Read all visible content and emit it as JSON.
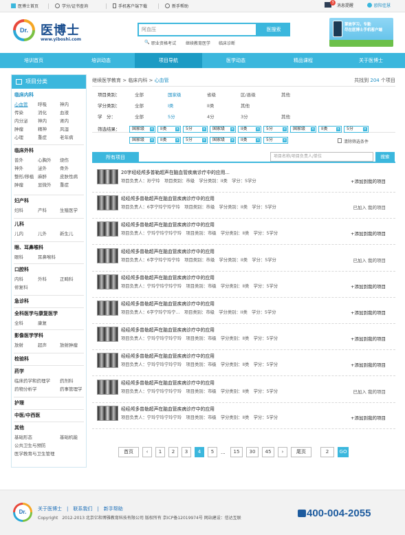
{
  "topbar": {
    "home": "医博士首页",
    "credit": "学分/证书查询",
    "mobile": "手机客户端下载",
    "help": "新手帮助",
    "messages": "消息提醒",
    "message_count": "3",
    "user": "欧阳佳慧"
  },
  "logo": {
    "badge": "Dr.",
    "name": "医博士",
    "url": "www.yiboshi.com"
  },
  "search": {
    "value": "阿血压",
    "button": "医搜索",
    "hot": [
      "职业资格考试",
      "继续教育医学",
      "临床诊断"
    ]
  },
  "banner": {
    "line1": "掌故学习，专勤",
    "line2": "尽在医博士手机客户端"
  },
  "nav": [
    "培训首页",
    "培训动态",
    "项目导航",
    "医学动态",
    "精品课程",
    "关于医博士"
  ],
  "sidebar": {
    "title": "项目分类",
    "groups": [
      {
        "name": "临床内科",
        "items": [
          "心血管",
          "呼吸",
          "神内",
          "传染",
          "消化",
          "血液",
          "内分泌",
          "神内",
          "肾内",
          "肿瘤",
          "精神",
          "风湿",
          "心理",
          "重症",
          "老年病"
        ]
      },
      {
        "name": "临床外科",
        "items": [
          "普外",
          "心胸外",
          "烧伤",
          "神外",
          "泌外",
          "骨外",
          "整形/移植",
          "麻醉",
          "皮肤性病",
          "肿瘤",
          "显微外",
          "重症"
        ]
      },
      {
        "name": "妇产科",
        "items": [
          "妇科",
          "产科",
          "生殖医学"
        ]
      },
      {
        "name": "儿科",
        "items": [
          "儿内",
          "儿外",
          "新生儿"
        ]
      },
      {
        "name": "眼、耳鼻喉科",
        "items": [
          "眼科",
          "耳鼻喉科"
        ]
      },
      {
        "name": "口腔科",
        "items": [
          "内科",
          "外科",
          "正畸科",
          "修复科"
        ]
      },
      {
        "name": "急诊科",
        "items": []
      },
      {
        "name": "全科医学与康复医学",
        "items": [
          "全科",
          "康复"
        ]
      },
      {
        "name": "影像医学学科",
        "items": [
          "放射",
          "超声",
          "放射肿瘤"
        ]
      },
      {
        "name": "检验科",
        "items": []
      },
      {
        "name": "药学",
        "items": [
          "临床药学和药理学",
          "药剂科",
          "药物分析学",
          "药事管理学"
        ]
      },
      {
        "name": "护理",
        "items": []
      },
      {
        "name": "中医/中西医",
        "items": []
      },
      {
        "name": "其他",
        "items": [
          "基础形态",
          "基础机能",
          "公共卫生与预防",
          "医学教育与卫生管理"
        ]
      }
    ]
  },
  "breadcrumb": {
    "a": "继续医学教育",
    "b": "临床内科",
    "c": "心血管"
  },
  "found": {
    "prefix": "共找到",
    "count": "204",
    "suffix": "个项目"
  },
  "filters": {
    "type_label": "项目类别：",
    "type_options": [
      "全部",
      "国家级",
      "省级",
      "区/县级",
      "其他"
    ],
    "credit_label": "学分类别：",
    "credit_options": [
      "全部",
      "I类",
      "II类",
      "其他"
    ],
    "score_label": "学　分：",
    "score_options": [
      "全部",
      "5分",
      "4分",
      "3分",
      "其他"
    ],
    "result_label": "筛选结果：",
    "tags_row1": [
      "国家级",
      "II类",
      "5分",
      "国家级",
      "II类",
      "5分",
      "国家级",
      "II类",
      "5分"
    ],
    "tags_row2": [
      "国家级",
      "II类",
      "5分",
      "国家级",
      "II类",
      "5分"
    ],
    "clear": "清除筛选条件"
  },
  "list": {
    "tab": "所有项目",
    "filter_placeholder": "项目名称/项目负责人/单位",
    "filter_button": "搜索",
    "items": [
      {
        "title": "20字经经颅多普勒超声在脑血管疾病诊疗中的应用...",
        "meta": "项目负责人：孙宁玲　项目类别：市级　学分类别：II类　学分：5学分",
        "action": "+添加到我的项目"
      },
      {
        "title": "经经颅多普勒超声在脑血管疾病诊疗中的应用",
        "meta": "项目负责人：6字宁玲宁玲宁玲　项目类别：市级　学分类别：II类　学分：5学分",
        "action": "已加入 我的项目"
      },
      {
        "title": "经经颅多普勒超声在脑血管疾病诊疗中的应用",
        "meta": "项目负责人：宁玲宁玲宁玲宁玲　项目类别：市级　学分类别：II类　学分：5学分",
        "action": "+添加到我的项目"
      },
      {
        "title": "经经颅多普勒超声在脑血管疾病诊疗中的应用",
        "meta": "项目负责人：6字宁玲宁玲宁玲　项目类别：市级　学分类别：II类　学分：5学分",
        "action": "已加入 我的项目"
      },
      {
        "title": "经经颅多普勒超声在脑血管疾病诊疗中的应用",
        "meta": "项目负责人：宁玲宁玲宁玲宁玲　项目类别：市级　学分类别：II类　学分：5学分",
        "action": "+添加到我的项目"
      },
      {
        "title": "经经颅多普勒超声在脑血管疾病诊疗中的应用",
        "meta": "项目负责人：6字宁玲宁玲宁...　项目类别：市级　学分类别：II类　学分：5学分",
        "action": "+添加到我的项目"
      },
      {
        "title": "经经颅多普勒超声在脑血管疾病诊疗中的应用",
        "meta": "项目负责人：宁玲宁玲宁玲宁玲　项目类别：市级　学分类别：II类　学分：5学分",
        "action": "+添加到我的项目"
      },
      {
        "title": "经经颅多普勒超声在脑血管疾病诊疗中的应用",
        "meta": "项目负责人：宁玲宁玲宁玲宁玲　项目类别：市级　学分类别：II类　学分：5学分",
        "action": "+添加到我的项目"
      },
      {
        "title": "经经颅多普勒超声在脑血管疾病诊疗中的应用",
        "meta": "项目负责人：宁玲宁玲宁玲宁玲　项目类别：市级　学分类别：II类　学分：5学分",
        "action": "已加入 我的项目"
      },
      {
        "title": "经经颅多普勒超声在脑血管疾病诊疗中的应用",
        "meta": "项目负责人：宁玲宁玲宁玲宁玲　项目类别：市级　学分类别：II类　学分：5学分",
        "action": "+添加到我的项目"
      }
    ]
  },
  "pager": {
    "first": "首页",
    "prev": "‹",
    "pages": [
      "1",
      "2",
      "3",
      "4",
      "5"
    ],
    "current": "4",
    "ellipsis": "...",
    "tail": [
      "15",
      "30",
      "45"
    ],
    "next": "›",
    "last": "尾页",
    "jump_value": "2",
    "go": "GO"
  },
  "footer": {
    "links": "关于医博士　|　联系我们　|　新手帮助",
    "copyright": "Copyright　2012-2013 北京亿和博雅教育科技有限公司 版权所有 京ICP备12019974号 网站建设：信达互联",
    "hotline": "400-004-2055"
  }
}
